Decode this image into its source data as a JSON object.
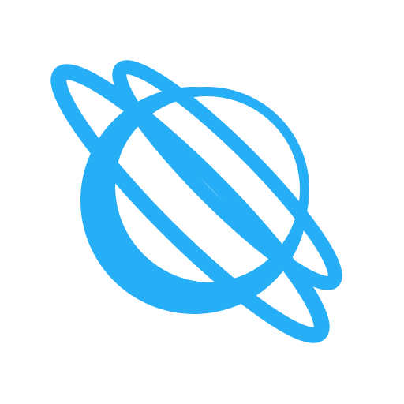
{
  "icon": {
    "name": "planet-orbit-icon",
    "color": "#26aef6",
    "background": "#ffffff"
  }
}
